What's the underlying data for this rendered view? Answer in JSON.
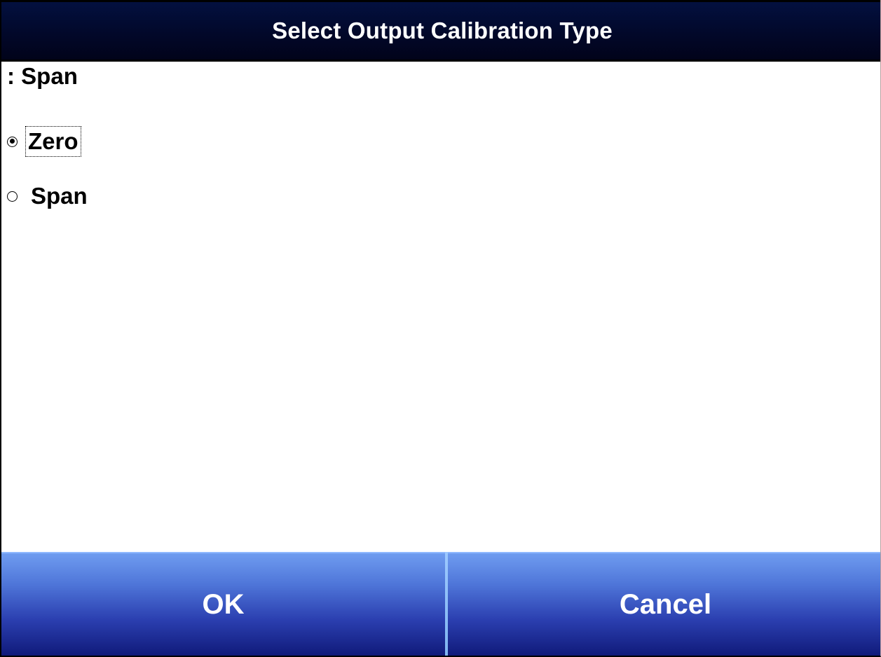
{
  "dialog": {
    "title": "Select Output Calibration Type",
    "current_prefix": ":",
    "current_value": "Span"
  },
  "options": [
    {
      "label": "Zero",
      "selected": true
    },
    {
      "label": "Span",
      "selected": false
    }
  ],
  "buttons": {
    "ok_label": "OK",
    "cancel_label": "Cancel"
  },
  "colors": {
    "title_bar": "#02082a",
    "button_top": "#6f9cf0",
    "button_bottom": "#101a7a",
    "text": "#000000"
  }
}
